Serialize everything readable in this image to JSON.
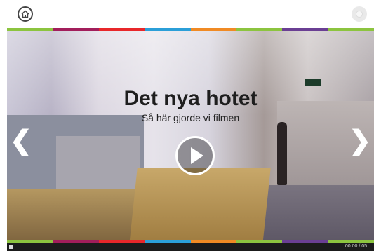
{
  "video": {
    "title": "Det nya hotet",
    "subtitle": "Så här gjorde vi filmen",
    "timecode": "00:00 / 05:"
  },
  "icons": {
    "home": "home-icon",
    "menu": "menu-icon",
    "play": "play-icon",
    "prev": "chevron-left-icon",
    "next": "chevron-right-icon"
  },
  "stripe_colors": [
    "#8cc43f",
    "#a21e5b",
    "#e8272a",
    "#2b9fd8",
    "#f08a24",
    "#8cc43f",
    "#6a3f93",
    "#8cc43f"
  ]
}
